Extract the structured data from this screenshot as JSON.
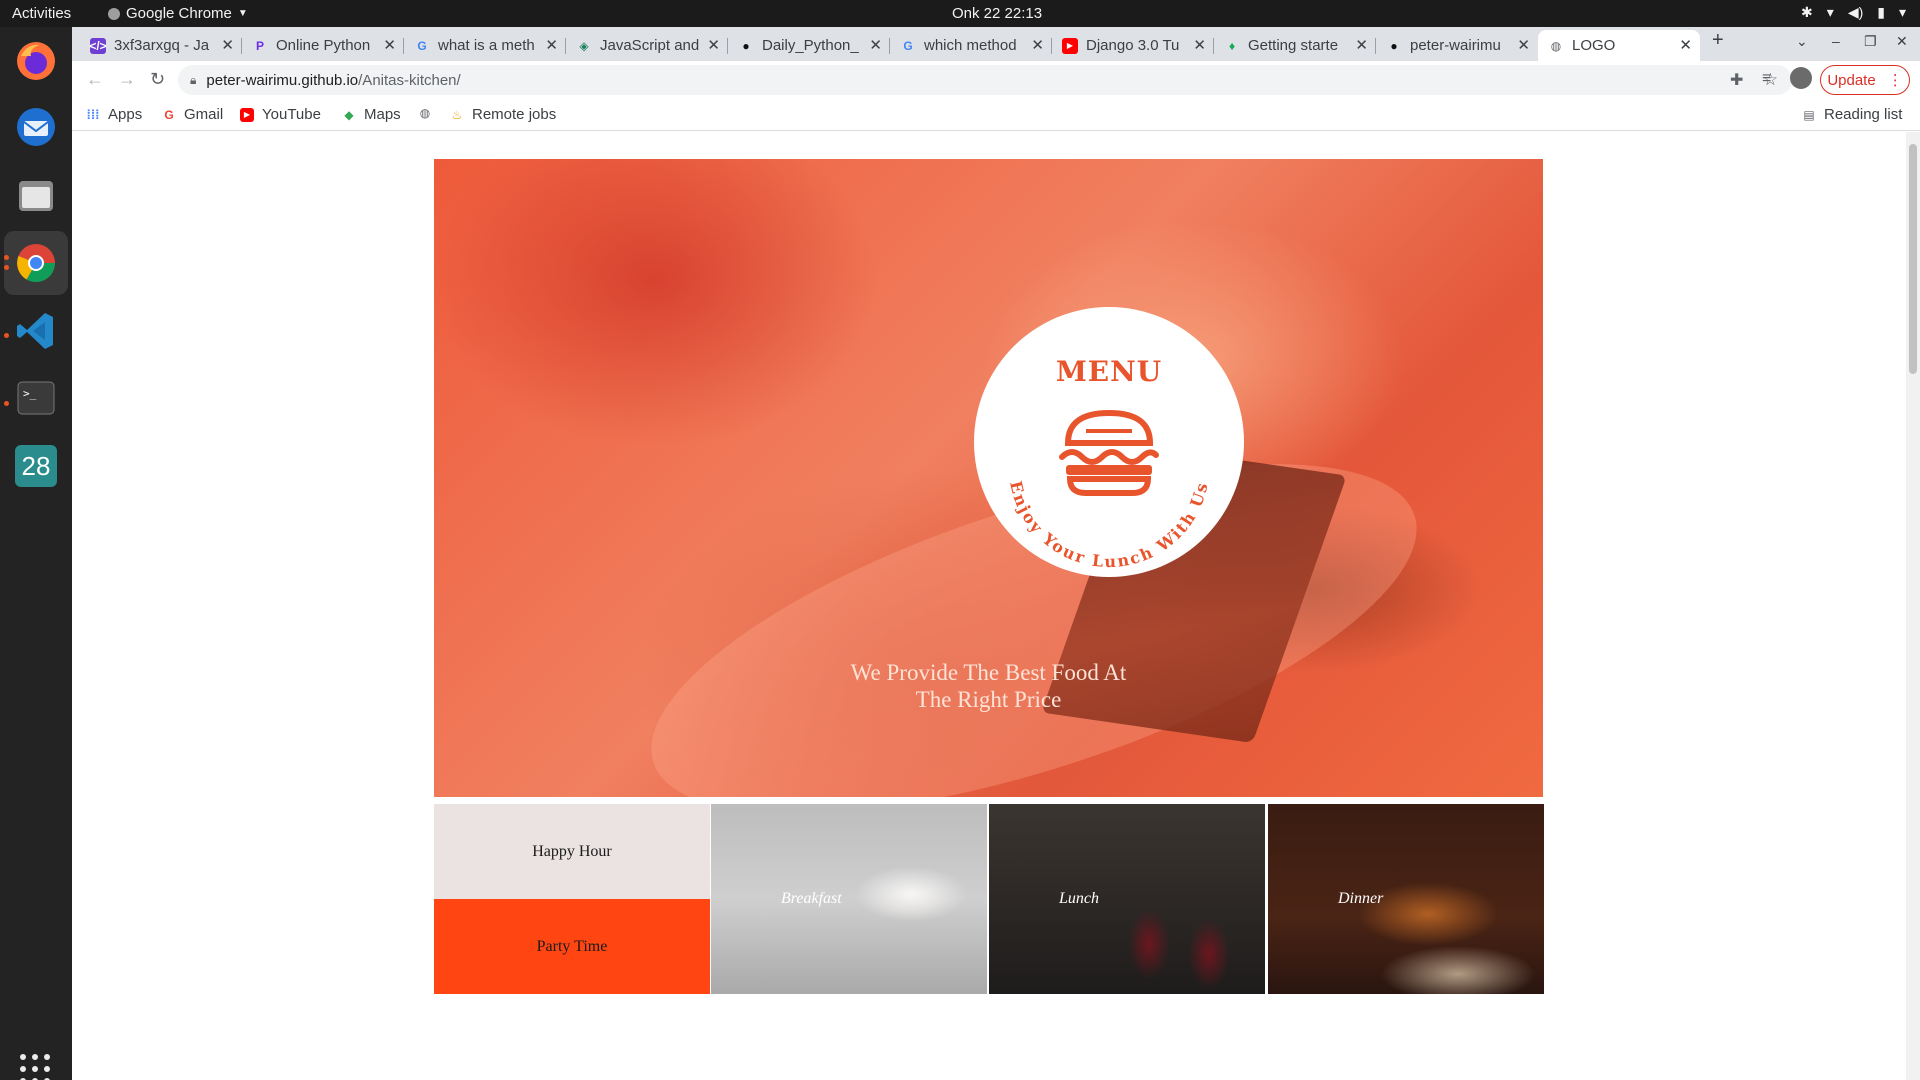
{
  "system": {
    "activities": "Activities",
    "app_name": "Google Chrome",
    "clock": "Onk 22  22:13",
    "dock_calendar_day": "28"
  },
  "browser": {
    "tabs": [
      {
        "title": "3xf3arxgq - Ja",
        "favicon": "replit-icon"
      },
      {
        "title": "Online Python",
        "favicon": "programiz-icon"
      },
      {
        "title": "what is a meth",
        "favicon": "google-icon"
      },
      {
        "title": "JavaScript and",
        "favicon": "freecodecamp-icon"
      },
      {
        "title": "Daily_Python_",
        "favicon": "github-icon"
      },
      {
        "title": "which method",
        "favicon": "google-icon"
      },
      {
        "title": "Django 3.0 Tu",
        "favicon": "youtube-icon"
      },
      {
        "title": "Getting starte",
        "favicon": "leaf-icon"
      },
      {
        "title": "peter-wairimu",
        "favicon": "github-icon"
      },
      {
        "title": "LOGO",
        "favicon": "globe-icon",
        "active": true
      }
    ],
    "url_host": "peter-wairimu.github.io",
    "url_path": "/Anitas-kitchen/",
    "update_label": "Update",
    "bookmarks": [
      "Apps",
      "Gmail",
      "YouTube",
      "Maps",
      "",
      "Remote jobs"
    ],
    "reading_list": "Reading list"
  },
  "page": {
    "logo_title": "MENU",
    "logo_arc_text": "Enjoy Your Lunch With Us",
    "tagline_line1": "We Provide The Best Food At",
    "tagline_line2": "The Right Price",
    "tiles": {
      "happy_hour": "Happy Hour",
      "party_time": "Party Time",
      "breakfast": "Breakfast",
      "lunch": "Lunch",
      "dinner": "Dinner"
    },
    "colors": {
      "accent": "#e8552d",
      "party": "#ff4612",
      "happy": "#ebe2e2"
    }
  }
}
